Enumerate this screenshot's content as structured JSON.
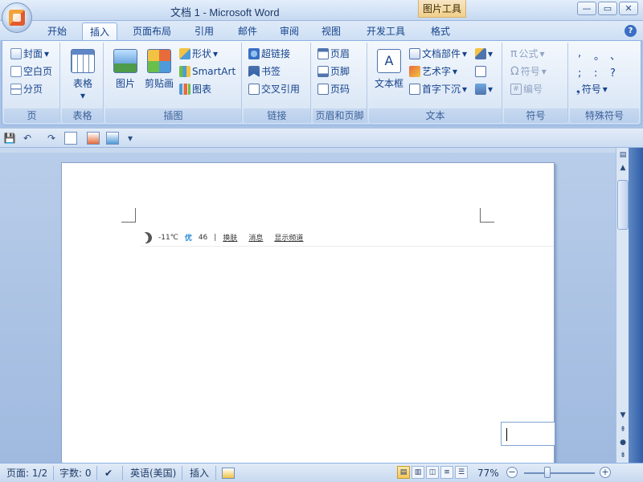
{
  "window": {
    "title": "文档 1 - Microsoft Word",
    "context_tab_title": "图片工具",
    "controls": {
      "minimize": "—",
      "restore": "▭",
      "close": "✕"
    }
  },
  "tabs": [
    {
      "label": "开始"
    },
    {
      "label": "插入"
    },
    {
      "label": "页面布局"
    },
    {
      "label": "引用"
    },
    {
      "label": "邮件"
    },
    {
      "label": "审阅"
    },
    {
      "label": "视图"
    },
    {
      "label": "开发工具"
    },
    {
      "label": "格式"
    }
  ],
  "active_tab": "插入",
  "help": "?",
  "ribbon": {
    "page": {
      "label": "页",
      "items": [
        {
          "label": "封面"
        },
        {
          "label": "空白页"
        },
        {
          "label": "分页"
        }
      ]
    },
    "table": {
      "label": "表格",
      "button": "表格"
    },
    "illustrations": {
      "label": "插图",
      "big": [
        {
          "label": "图片"
        },
        {
          "label": "剪贴画"
        }
      ],
      "small": [
        {
          "label": "形状"
        },
        {
          "label": "SmartArt"
        },
        {
          "label": "图表"
        }
      ]
    },
    "links": {
      "label": "链接",
      "items": [
        {
          "label": "超链接"
        },
        {
          "label": "书签"
        },
        {
          "label": "交叉引用"
        }
      ]
    },
    "header_footer": {
      "label": "页眉和页脚",
      "items": [
        {
          "label": "页眉"
        },
        {
          "label": "页脚"
        },
        {
          "label": "页码"
        }
      ]
    },
    "text": {
      "label": "文本",
      "big": "文本框",
      "items": [
        {
          "label": "文档部件"
        },
        {
          "label": "艺术字"
        },
        {
          "label": "首字下沉"
        }
      ]
    },
    "symbols": {
      "label": "符号",
      "items": [
        {
          "label": "公式"
        },
        {
          "label": "符号"
        },
        {
          "label": "编号"
        }
      ]
    },
    "special_symbols": {
      "label": "特殊符号",
      "grid": [
        ",",
        "。",
        "、",
        ";",
        ":",
        "?"
      ],
      "button": "符号"
    }
  },
  "qat": {
    "save": "💾",
    "undo": "↶",
    "redo": "↷",
    "customize": "▾"
  },
  "document": {
    "weather": {
      "temp": "-11℃",
      "aqi_label": "优",
      "aqi_value": "46",
      "divider": "|",
      "links": [
        "换肤",
        "消息",
        "显示频道"
      ]
    }
  },
  "statusbar": {
    "page": "页面: 1/2",
    "words": "字数: 0",
    "language": "英语(美国)",
    "mode": "插入",
    "zoom": "77%",
    "zoom_minus": "−",
    "zoom_plus": "+"
  },
  "colors": {
    "ribbon_bg": "#dbe7f6",
    "accent": "#15428b",
    "aqi": "#2a8bd6"
  }
}
